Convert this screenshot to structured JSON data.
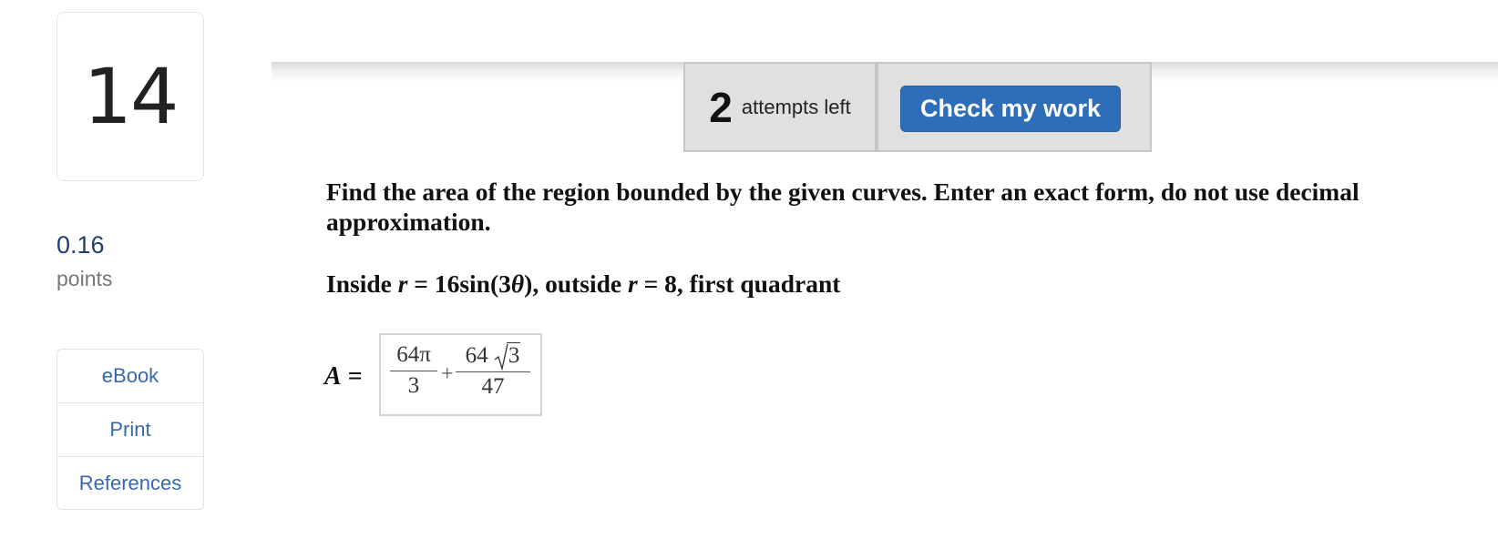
{
  "question": {
    "number": "14",
    "points_value": "0.16",
    "points_label": "points"
  },
  "resources": {
    "items": [
      {
        "label": "eBook"
      },
      {
        "label": "Print"
      },
      {
        "label": "References"
      }
    ]
  },
  "attempts": {
    "count": "2",
    "text": "attempts left"
  },
  "check_button": {
    "label": "Check my work"
  },
  "prompt": {
    "text": "Find the area of the region bounded by the given curves. Enter an exact form, do not use decimal approximation."
  },
  "region": {
    "prefix": "Inside ",
    "r1_var": "r",
    "r1_rest": " = 16sin(3",
    "theta": "θ",
    "r1_end": "), outside ",
    "r2_var": "r",
    "r2_rest": " = 8, first quadrant"
  },
  "answer": {
    "label_var": "A",
    "label_eq": " =",
    "term1": {
      "numerator": "64π",
      "denominator": "3"
    },
    "operator": "+",
    "term2": {
      "numerator_coeff": "64",
      "radicand": "3",
      "denominator": "47"
    }
  },
  "colors": {
    "button_blue": "#2e6db8",
    "link_blue": "#3868ad",
    "points_blue": "#1f3e73"
  }
}
